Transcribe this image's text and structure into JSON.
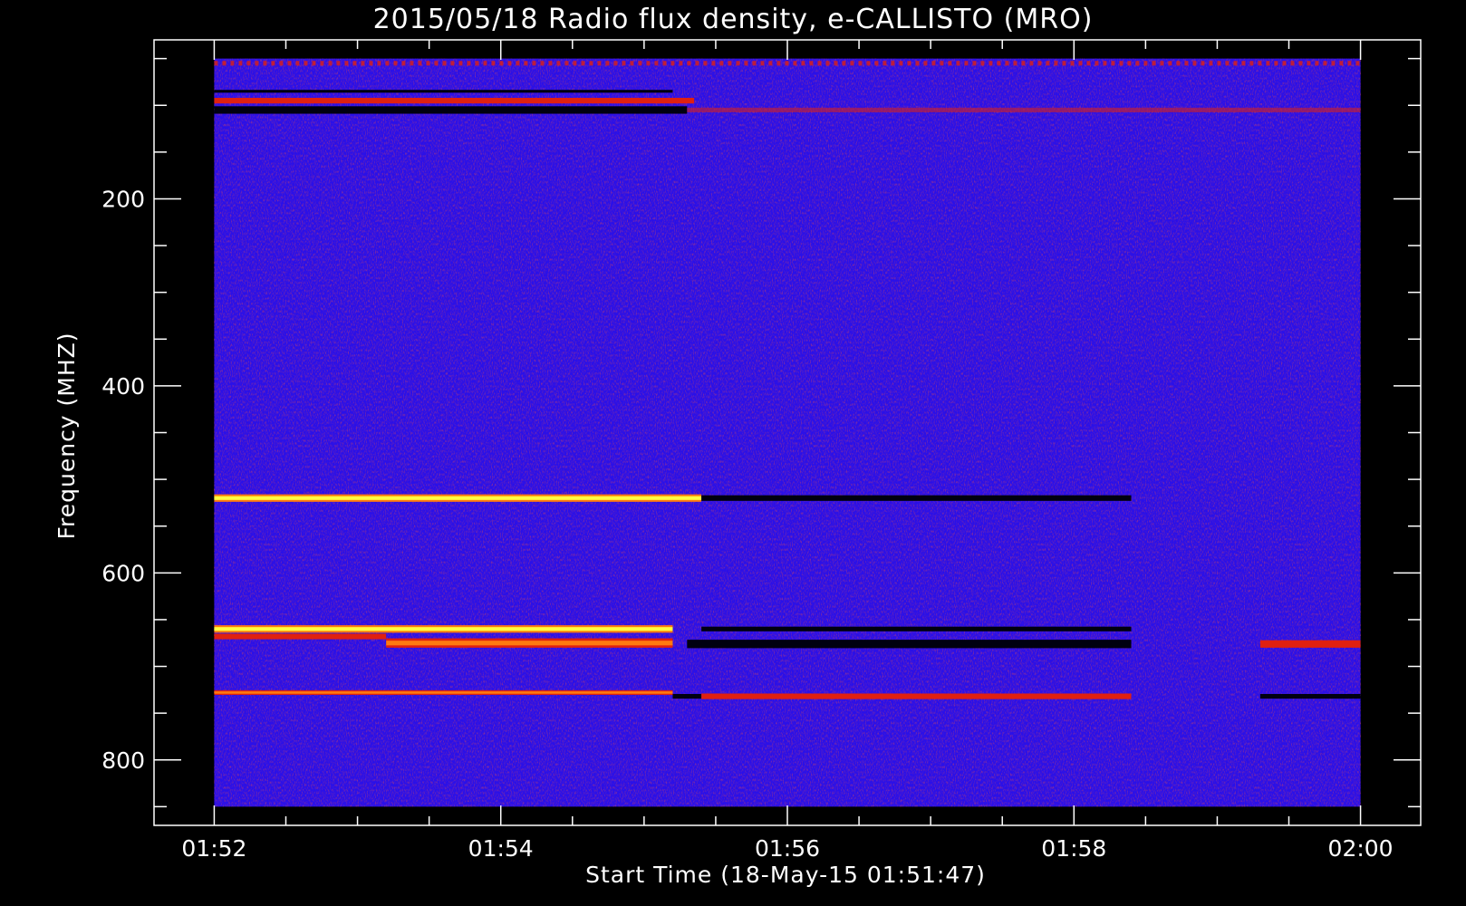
{
  "chart_data": {
    "type": "heatmap",
    "title": "2015/05/18  Radio flux density, e-CALLISTO (MRO)",
    "xlabel": "Start Time (18-May-15 01:51:47)",
    "ylabel": "Frequency (MHZ)",
    "x_tick_labels": [
      "01:52",
      "01:54",
      "01:56",
      "01:58",
      "02:00"
    ],
    "x_ticks_min": [
      0,
      2,
      4,
      6,
      8
    ],
    "xlim_min": [
      -0.42,
      8.42
    ],
    "data_xrange_min": [
      0,
      8
    ],
    "y_ticks": [
      200,
      400,
      600,
      800
    ],
    "y_tick_labels": [
      "200",
      "400",
      "600",
      "800"
    ],
    "ylim": [
      870,
      30
    ],
    "data_yrange": [
      50,
      850
    ],
    "colors": {
      "background_field": "#2a10e8",
      "hot_band_core": "#ffff40",
      "hot_band_edge": "#ff7a10",
      "warm_band": "#e02010",
      "dark_band": "#000010"
    },
    "bands": [
      {
        "freq": 55,
        "width": 5,
        "t_start": 0,
        "t_end": 8,
        "kind": "dotted_warm"
      },
      {
        "freq": 85,
        "width": 3,
        "t_start": 0,
        "t_end": 3.2,
        "kind": "dark"
      },
      {
        "freq": 95,
        "width": 6,
        "t_start": 0,
        "t_end": 3.35,
        "kind": "warm"
      },
      {
        "freq": 105,
        "width": 8,
        "t_start": 0,
        "t_end": 3.3,
        "kind": "dark"
      },
      {
        "freq": 105,
        "width": 5,
        "t_start": 3.3,
        "t_end": 8,
        "kind": "faint_warm"
      },
      {
        "freq": 520,
        "width": 8,
        "t_start": 0,
        "t_end": 3.2,
        "kind": "hot"
      },
      {
        "freq": 520,
        "width": 8,
        "t_start": 3.2,
        "t_end": 3.4,
        "kind": "hot_fragment"
      },
      {
        "freq": 520,
        "width": 6,
        "t_start": 3.4,
        "t_end": 6.4,
        "kind": "dark"
      },
      {
        "freq": 660,
        "width": 8,
        "t_start": 0,
        "t_end": 3.2,
        "kind": "hot"
      },
      {
        "freq": 675,
        "width": 10,
        "t_start": 1.2,
        "t_end": 3.2,
        "kind": "warm_hot"
      },
      {
        "freq": 668,
        "width": 6,
        "t_start": 0,
        "t_end": 1.2,
        "kind": "warm"
      },
      {
        "freq": 660,
        "width": 5,
        "t_start": 3.4,
        "t_end": 6.4,
        "kind": "dark"
      },
      {
        "freq": 676,
        "width": 9,
        "t_start": 3.3,
        "t_end": 6.4,
        "kind": "dark"
      },
      {
        "freq": 676,
        "width": 8,
        "t_start": 7.3,
        "t_end": 8,
        "kind": "warm"
      },
      {
        "freq": 728,
        "width": 5,
        "t_start": 0,
        "t_end": 3.2,
        "kind": "warm_hot"
      },
      {
        "freq": 732,
        "width": 5,
        "t_start": 3.2,
        "t_end": 3.4,
        "kind": "dark"
      },
      {
        "freq": 732,
        "width": 6,
        "t_start": 3.4,
        "t_end": 6.4,
        "kind": "warm"
      },
      {
        "freq": 732,
        "width": 5,
        "t_start": 7.3,
        "t_end": 8,
        "kind": "dark"
      }
    ]
  }
}
